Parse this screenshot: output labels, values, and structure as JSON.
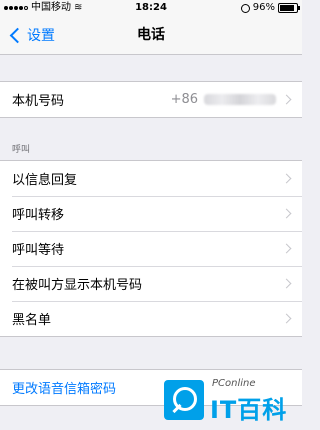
{
  "status_bar": {
    "carrier": "中国移动",
    "time": "18:24",
    "battery": "96%"
  },
  "nav": {
    "back_label": "设置",
    "title": "电话"
  },
  "my_number": {
    "label": "本机号码",
    "value_prefix": "+86"
  },
  "calls_section": {
    "header": "呼叫",
    "items": [
      {
        "label": "以信息回复"
      },
      {
        "label": "呼叫转移"
      },
      {
        "label": "呼叫等待"
      },
      {
        "label": "在被叫方显示本机号码"
      },
      {
        "label": "黑名单"
      }
    ]
  },
  "voicemail": {
    "label": "更改语音信箱密码"
  },
  "watermark": {
    "small": "PConline",
    "big": "IT百科"
  },
  "colors": {
    "accent": "#007aff",
    "background": "#efeff4",
    "watermark": "#00a0e9"
  }
}
